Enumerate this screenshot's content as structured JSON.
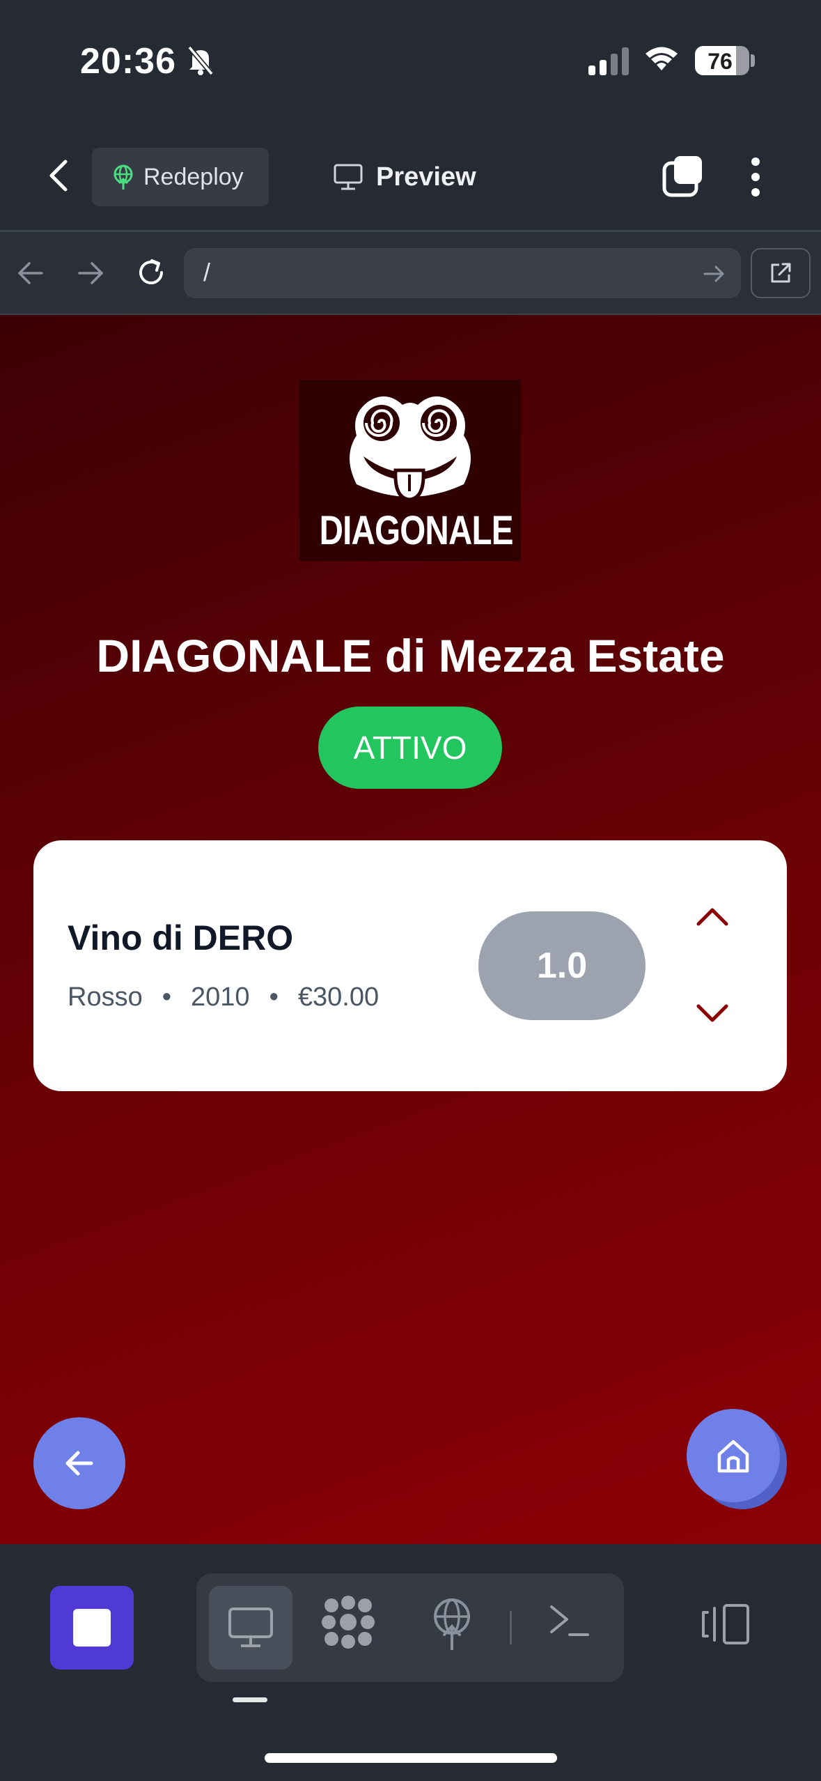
{
  "status_bar": {
    "time": "20:36",
    "battery": "76",
    "battery_level": 0.76
  },
  "header": {
    "redeploy_label": "Redeploy",
    "preview_label": "Preview"
  },
  "browser": {
    "url": "/"
  },
  "page": {
    "logo_text": "DIAGONALE",
    "title": "DIAGONALE di Mezza Estate",
    "status": "ATTIVO",
    "wine": {
      "name": "Vino di DERO",
      "type": "Rosso",
      "year": "2010",
      "price": "€30.00",
      "quantity": "1.0"
    }
  },
  "colors": {
    "accent": "#6f80e8",
    "active_badge": "#22c55e",
    "stop_button": "#4f3ad6",
    "background_top": "#3c0004",
    "background_bottom": "#8b0006"
  }
}
